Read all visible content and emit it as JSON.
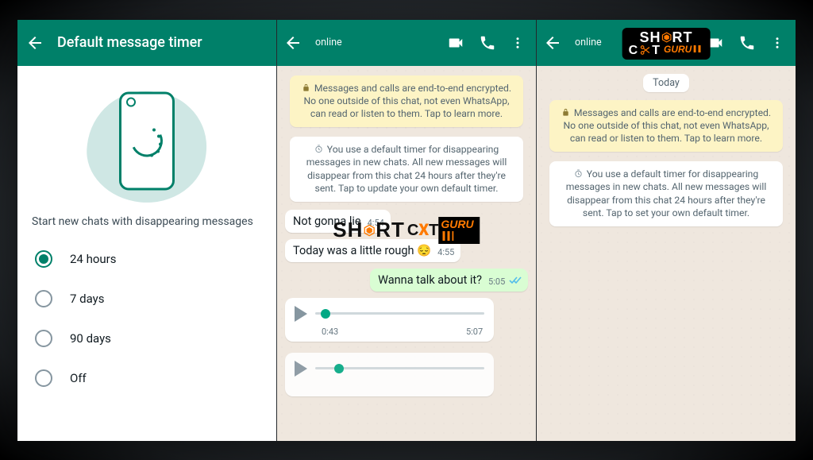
{
  "panel1": {
    "title": "Default message timer",
    "caption": "Start new chats with disappearing messages",
    "options": [
      "24 hours",
      "7 days",
      "90 days",
      "Off"
    ],
    "selected": 0
  },
  "panel2": {
    "status": "online",
    "encryption_notice": "Messages and calls are end-to-end encrypted. No one outside of this chat, not even WhatsApp, can read or listen to them. Tap to learn more.",
    "timer_notice": "You use a default timer for disappearing messages in new chats. All new messages will disappear from this chat 24 hours after they're sent. Tap to update your own default timer.",
    "messages": [
      {
        "text": "Not gonna lie",
        "time": "4:54",
        "out": false
      },
      {
        "text": "Today was a little rough 😔",
        "time": "4:55",
        "out": false
      },
      {
        "text": "Wanna talk about it?",
        "time": "5:05",
        "out": true,
        "read": true
      }
    ],
    "voice": {
      "elapsed": "0:43",
      "total": "5:07"
    }
  },
  "panel3": {
    "status": "online",
    "date_pill": "Today",
    "encryption_notice": "Messages and calls are end-to-end encrypted. No one outside of this chat, not even WhatsApp, can read or listen to them. Tap to learn more.",
    "timer_notice": "You use a default timer for disappearing messages in new chats. All new messages will disappear from this chat 24 hours after they're sent. Tap to set your own default timer."
  },
  "watermark": {
    "brand": "SHORTCUT GURU"
  }
}
